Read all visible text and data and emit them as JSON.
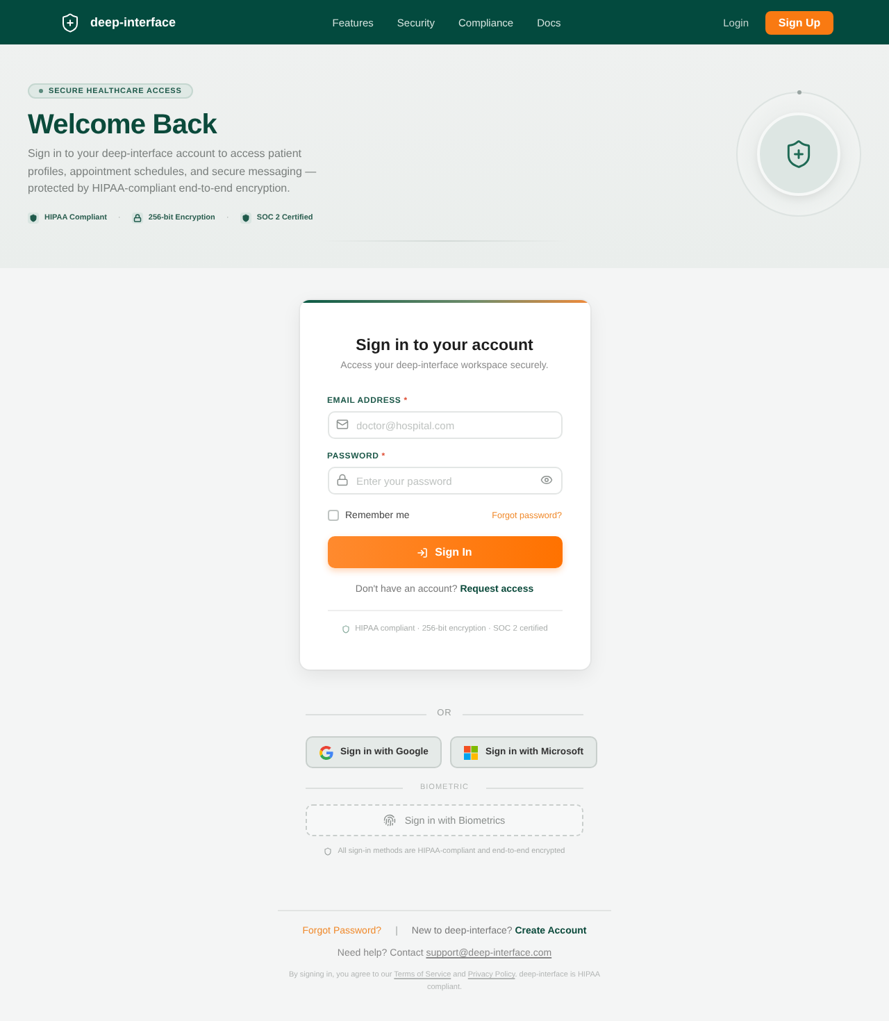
{
  "header": {
    "brand": "deep-interface",
    "nav": [
      {
        "label": "Features"
      },
      {
        "label": "Security"
      },
      {
        "label": "Compliance"
      },
      {
        "label": "Docs"
      }
    ],
    "login": "Login",
    "signup": "Sign Up"
  },
  "hero": {
    "badge": "SECURE HEALTHCARE ACCESS",
    "title": "Welcome Back",
    "description": "Sign in to your deep-interface account to access patient profiles, appointment schedules, and secure messaging — protected by HIPAA-compliant end-to-end encryption.",
    "trust_items": [
      {
        "kind": "shield",
        "label": "HIPAA Compliant"
      },
      {
        "kind": "lock",
        "label": "256-bit Encryption"
      },
      {
        "kind": "shield",
        "label": "SOC 2 Certified"
      }
    ],
    "trust_separator": "·"
  },
  "signin_card": {
    "title": "Sign in to your account",
    "subtitle": "Access your deep-interface workspace securely.",
    "fields": [
      {
        "kind": "email",
        "label": "EMAIL ADDRESS",
        "required_mark": "*",
        "placeholder": "doctor@hospital.com"
      },
      {
        "kind": "password",
        "label": "PASSWORD",
        "required_mark": "*",
        "placeholder": "Enter your password"
      }
    ],
    "remember": {
      "label": "Remember me",
      "checked": false
    },
    "forgot": "Forgot password?",
    "submit": "Sign In",
    "request_prompt": "Don't have an account?",
    "request_link": "Request access",
    "compliance_note": "HIPAA compliant · 256-bit encryption · SOC 2 certified"
  },
  "alternatives": {
    "or": "OR",
    "providers": [
      {
        "kind": "google",
        "label": "Sign in with Google"
      },
      {
        "kind": "microsoft",
        "label": "Sign in with Microsoft"
      }
    ],
    "biometric_heading": "BIOMETRIC",
    "biometric_button": "Sign in with Biometrics",
    "note": "All sign-in methods are HIPAA-compliant and end-to-end encrypted"
  },
  "footer": {
    "forgot": "Forgot Password?",
    "separator": "|",
    "new_prompt": "New to deep-interface?",
    "create": "Create Account",
    "help": [
      {
        "kind": "text",
        "text": "Need help? Contact "
      },
      {
        "kind": "link",
        "text": "support@deep-interface.com"
      }
    ],
    "legal": [
      {
        "kind": "text",
        "text": "By signing in, you agree to our "
      },
      {
        "kind": "link",
        "text": "Terms of Service"
      },
      {
        "kind": "text",
        "text": " and "
      },
      {
        "kind": "link",
        "text": "Privacy Policy"
      },
      {
        "kind": "text",
        "text": ". deep-interface is HIPAA compliant."
      }
    ]
  }
}
